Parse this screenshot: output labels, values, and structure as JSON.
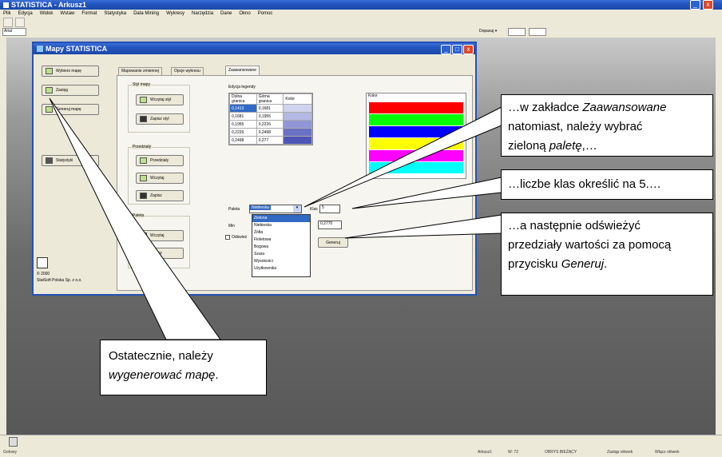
{
  "app": {
    "title": "STATISTICA - Arkusz1",
    "menu": [
      "Plik",
      "Edycja",
      "Widok",
      "Wstaw",
      "Format",
      "Statystyka",
      "Data Mining",
      "Wykresy",
      "Narzędzia",
      "Dane",
      "Okno",
      "Pomoc"
    ],
    "font_box": "Arial",
    "toolbar_right_label": "Dopasuj",
    "status_left": "Gotowy",
    "status_items": [
      "Arkusz1",
      "W: 72",
      "OBRYS BIEŻĄCY",
      "Zastąp ołówek",
      "Włącz ołówek"
    ]
  },
  "dialog": {
    "title": "Mapy STATISTICA",
    "left_buttons": [
      "Wybierz mapę",
      "Zasięg",
      "Generuj mapę",
      "Statystyki"
    ],
    "tabs": [
      "Mapowanie zmiennej",
      "Opcje wykresu",
      "Zaawansowane"
    ],
    "active_tab": "Zaawansowane",
    "styl_group": "Styl mapy",
    "styl_buttons": [
      "Wczytaj styl",
      "Zapisz styl"
    ],
    "przedzialy_group": "Przedziały",
    "przedzialy_buttons": [
      "Przedziały",
      "Wczytaj",
      "Zapisz"
    ],
    "paleta_group": "Paleta",
    "paleta_buttons": [
      "Wczytaj",
      "Zapisz"
    ],
    "legend_group": "Edycja legendy",
    "legend_headers": [
      "Dolna granica",
      "Górna granica",
      "Kolor"
    ],
    "legend_rows": [
      {
        "low": "0,1413",
        "high": "0,1681"
      },
      {
        "low": "0,1681",
        "high": "0,1955"
      },
      {
        "low": "0,1955",
        "high": "0,2226"
      },
      {
        "low": "0,2226",
        "high": "0,2498"
      },
      {
        "low": "0,2498",
        "high": "0,277"
      }
    ],
    "swatch_colors": [
      "#cfd3ee",
      "#b3b9e3",
      "#9096d6",
      "#6a70c4",
      "#4d55b6"
    ],
    "color_bar_header": "Kolor",
    "color_bars": [
      "#ff0000",
      "#00ff00",
      "#0000ff",
      "#ffff00",
      "#ff00ff",
      "#00ffff"
    ],
    "paleta_label": "Paleta",
    "paleta_value": "Niebieska",
    "klas_label": "Klas",
    "klas_value": "5",
    "min_label": "Min",
    "max_value": "0,2770",
    "odswiez_label": "Odśwież",
    "generuj_label": "Generuj",
    "palette_options": [
      "Zielona",
      "Niebieska",
      "Żółta",
      "Fioletowa",
      "Bogowa",
      "Szara",
      "Wysokości",
      "Użytkownika"
    ],
    "palette_selected": "Zielona",
    "copyright_year": "© 2000",
    "copyright_company": "StatSoft Polska Sp. z o.o."
  },
  "callouts": {
    "c1_pre": "…w zakładce ",
    "c1_italic": "Zaawansowane",
    "c1_line2": "natomiast, należy wybrać",
    "c1_line3_pre": "zieloną ",
    "c1_line3_italic": "paletę",
    "c1_line3_post": ",…",
    "c2": "…liczbe klas określić na 5.…",
    "c3_line1": "…a następnie odświeżyć",
    "c3_line2": "przedziały wartości za pomocą",
    "c3_line3_pre": "przycisku ",
    "c3_line3_italic": "Generuj",
    "c3_line3_post": ".",
    "c4_line1": "Ostatecznie, należy",
    "c4_line2_italic": "wygenerować mapę",
    "c4_line2_post": "."
  }
}
